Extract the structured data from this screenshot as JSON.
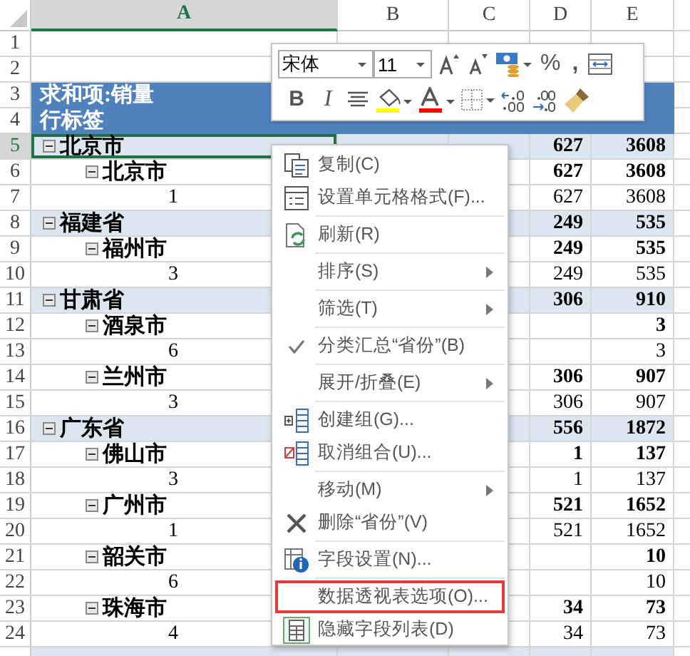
{
  "sheet": {
    "columns": [
      {
        "label": "A",
        "selected": true
      },
      {
        "label": "B",
        "selected": false
      },
      {
        "label": "C",
        "selected": false
      },
      {
        "label": "D",
        "selected": false
      },
      {
        "label": "E",
        "selected": false
      }
    ],
    "empty_rows": [
      "1",
      "2"
    ],
    "pivot_header": {
      "rows": [
        "3",
        "4"
      ],
      "title": "求和项:销量",
      "row_label": "行标签"
    },
    "pivot_rows": [
      {
        "row": "5",
        "label": "北京市",
        "values": {
          "d": "627",
          "e": "3608"
        },
        "selected": true,
        "expanded": true,
        "children": [
          {
            "row": "6",
            "label": "北京市",
            "values": {
              "d": "627",
              "e": "3608"
            },
            "selected": false,
            "expanded": true,
            "children": [
              {
                "row": "7",
                "label": "1",
                "values": {
                  "d": "627",
                  "e": "3608"
                },
                "selected": false
              }
            ]
          }
        ]
      },
      {
        "row": "8",
        "label": "福建省",
        "values": {
          "d": "249",
          "e": "535"
        },
        "selected": false,
        "expanded": true,
        "children": [
          {
            "row": "9",
            "label": "福州市",
            "values": {
              "d": "249",
              "e": "535"
            },
            "selected": false,
            "expanded": true,
            "children": [
              {
                "row": "10",
                "label": "3",
                "values": {
                  "d": "249",
                  "e": "535"
                },
                "selected": false
              }
            ]
          }
        ]
      },
      {
        "row": "11",
        "label": "甘肃省",
        "values": {
          "d": "306",
          "e": "910"
        },
        "selected": false,
        "expanded": true,
        "children": [
          {
            "row": "12",
            "label": "酒泉市",
            "values": {
              "e": "3"
            },
            "selected": false,
            "expanded": true,
            "children": [
              {
                "row": "13",
                "label": "6",
                "values": {
                  "e": "3"
                },
                "selected": false
              }
            ]
          },
          {
            "row": "14",
            "label": "兰州市",
            "values": {
              "d": "306",
              "e": "907"
            },
            "selected": false,
            "expanded": true,
            "children": [
              {
                "row": "15",
                "label": "3",
                "values": {
                  "d": "306",
                  "e": "907"
                },
                "selected": false
              }
            ]
          }
        ]
      },
      {
        "row": "16",
        "label": "广东省",
        "values": {
          "d": "556",
          "e": "1872"
        },
        "selected": false,
        "expanded": true,
        "children": [
          {
            "row": "17",
            "label": "佛山市",
            "values": {
              "d": "1",
              "e": "137"
            },
            "selected": false,
            "expanded": true,
            "children": [
              {
                "row": "18",
                "label": "3",
                "values": {
                  "d": "1",
                  "e": "137"
                },
                "selected": false
              }
            ]
          },
          {
            "row": "19",
            "label": "广州市",
            "values": {
              "d": "521",
              "e": "1652"
            },
            "selected": false,
            "expanded": true,
            "children": [
              {
                "row": "20",
                "label": "1",
                "values": {
                  "d": "521",
                  "e": "1652"
                },
                "selected": false
              }
            ]
          },
          {
            "row": "21",
            "label": "韶关市",
            "values": {
              "e": "10"
            },
            "selected": false,
            "expanded": true,
            "children": [
              {
                "row": "22",
                "label": "6",
                "values": {
                  "e": "10"
                },
                "selected": false
              }
            ]
          },
          {
            "row": "23",
            "label": "珠海市",
            "values": {
              "d": "34",
              "e": "73"
            },
            "selected": false,
            "expanded": true,
            "children": [
              {
                "row": "24",
                "label": "4",
                "values": {
                  "d": "34",
                  "e": "73"
                },
                "selected": false
              }
            ]
          }
        ]
      }
    ]
  },
  "mini_toolbar": {
    "font": "宋体",
    "size": "11",
    "percent_button": "%",
    "comma_button": ",",
    "bold_button": "B",
    "italic_button": "I"
  },
  "context_menu": [
    {
      "kind": "item",
      "label": "复制(C)",
      "checked": false,
      "submenu": false,
      "highlighted": false
    },
    {
      "kind": "item",
      "label": "设置单元格格式(F)...",
      "checked": false,
      "submenu": false,
      "highlighted": false
    },
    {
      "kind": "separator"
    },
    {
      "kind": "item",
      "label": "刷新(R)",
      "checked": false,
      "submenu": false,
      "highlighted": false
    },
    {
      "kind": "separator"
    },
    {
      "kind": "item",
      "label": "排序(S)",
      "checked": false,
      "submenu": true,
      "highlighted": false
    },
    {
      "kind": "separator"
    },
    {
      "kind": "item",
      "label": "筛选(T)",
      "checked": false,
      "submenu": true,
      "highlighted": false
    },
    {
      "kind": "separator"
    },
    {
      "kind": "item",
      "label": "分类汇总“省份”(B)",
      "checked": true,
      "submenu": false,
      "highlighted": false
    },
    {
      "kind": "separator"
    },
    {
      "kind": "item",
      "label": "展开/折叠(E)",
      "checked": false,
      "submenu": true,
      "highlighted": false
    },
    {
      "kind": "separator"
    },
    {
      "kind": "item",
      "label": "创建组(G)...",
      "checked": false,
      "submenu": false,
      "highlighted": false
    },
    {
      "kind": "item",
      "label": "取消组合(U)...",
      "checked": false,
      "submenu": false,
      "highlighted": false
    },
    {
      "kind": "separator"
    },
    {
      "kind": "item",
      "label": "移动(M)",
      "checked": false,
      "submenu": true,
      "highlighted": false
    },
    {
      "kind": "item",
      "label": "删除“省份”(V)",
      "checked": false,
      "submenu": false,
      "highlighted": false
    },
    {
      "kind": "separator"
    },
    {
      "kind": "item",
      "label": "字段设置(N)...",
      "checked": false,
      "submenu": false,
      "highlighted": false
    },
    {
      "kind": "separator"
    },
    {
      "kind": "item",
      "label": "数据透视表选项(O)...",
      "checked": false,
      "submenu": false,
      "highlighted": true
    },
    {
      "kind": "item",
      "label": "隐藏字段列表(D)",
      "checked": false,
      "submenu": false,
      "highlighted": false
    }
  ]
}
